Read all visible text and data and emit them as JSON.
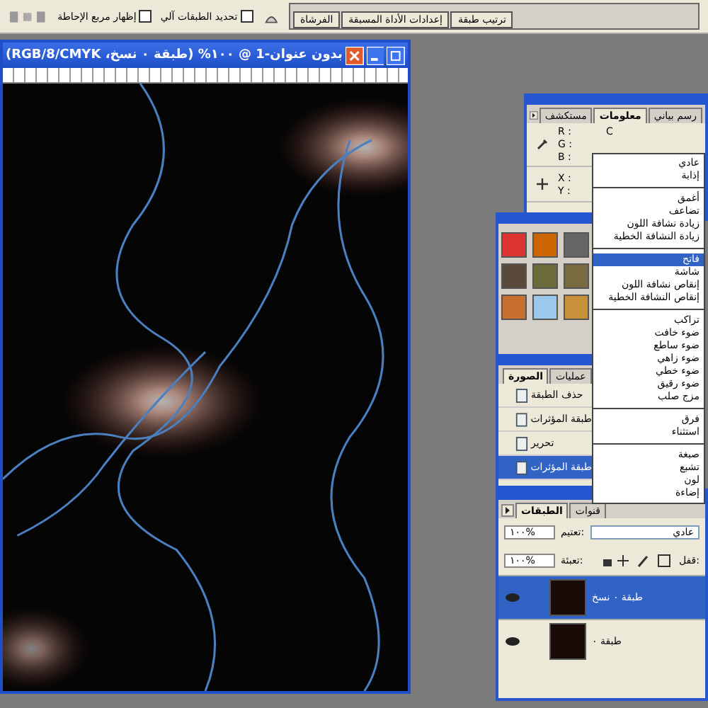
{
  "options_bar": {
    "checkboxes": [
      {
        "label": "تحديد الطبقات آلي",
        "checked": false
      },
      {
        "label": "إظهار مربع الإحاطة",
        "checked": false
      }
    ],
    "palette_tabs": [
      {
        "label": "ترتيب طبقة"
      },
      {
        "label": "إعدادات الأداة المسبقة"
      },
      {
        "label": "الفرشاة"
      }
    ]
  },
  "document": {
    "title": "بدون عنوان-1 @ ١٠٠% (طبقة ٠ نسخ، RGB/8/CMYK)"
  },
  "info_panel": {
    "tabs": [
      {
        "label": "رسم بياني",
        "selected": false
      },
      {
        "label": "معلومات",
        "selected": true
      },
      {
        "label": "مستكشف",
        "selected": false
      }
    ],
    "labels": [
      "R :",
      "G :",
      "B :"
    ],
    "c_label": "C",
    "xy_labels": [
      "X :",
      "Y :"
    ]
  },
  "blend_menu": {
    "groups": [
      [
        {
          "label": "عادي",
          "selected": false
        },
        {
          "label": "إذابة",
          "selected": false
        }
      ],
      [
        {
          "label": "أغمق",
          "selected": false
        },
        {
          "label": "تضاعف",
          "selected": false
        },
        {
          "label": "زيادة نشافة اللون",
          "selected": false
        },
        {
          "label": "زيادة النشافة الخطية",
          "selected": false
        }
      ],
      [
        {
          "label": "فاتح",
          "selected": true
        },
        {
          "label": "شاشة",
          "selected": false
        },
        {
          "label": "إنقاص نشافة اللون",
          "selected": false
        },
        {
          "label": "إنقاص النشافة الخطية",
          "selected": false
        }
      ],
      [
        {
          "label": "تراكب",
          "selected": false
        },
        {
          "label": "ضوء خافت",
          "selected": false
        },
        {
          "label": "ضوء ساطع",
          "selected": false
        },
        {
          "label": "ضوء زاهي",
          "selected": false
        },
        {
          "label": "ضوء خطي",
          "selected": false
        },
        {
          "label": "ضوء رقيق",
          "selected": false
        },
        {
          "label": "مزج صلب",
          "selected": false
        }
      ],
      [
        {
          "label": "فرق",
          "selected": false
        },
        {
          "label": "استثناء",
          "selected": false
        }
      ],
      [
        {
          "label": "صبغة",
          "selected": false
        },
        {
          "label": "تشبع",
          "selected": false
        },
        {
          "label": "لون",
          "selected": false
        },
        {
          "label": "إضاءة",
          "selected": false
        }
      ]
    ]
  },
  "history_panel": {
    "tabs": [
      {
        "label": "عمليات",
        "selected": false
      },
      {
        "label": "الصورة",
        "selected": true
      }
    ],
    "items": [
      {
        "label": "حذف الطبقة",
        "selected": false
      },
      {
        "label": "طبقة المؤثرات",
        "selected": false
      },
      {
        "label": "تحرير",
        "selected": false
      },
      {
        "label": "طبقة المؤثرات",
        "selected": true
      }
    ]
  },
  "layers_panel": {
    "tabs": [
      {
        "label": "قنوات",
        "selected": false
      },
      {
        "label": "الطبقات",
        "selected": true
      }
    ],
    "blend_mode": "عادي",
    "opacity_label": "تعتيم:",
    "opacity": "١٠٠%",
    "lock_label": "قفل:",
    "fill_label": "تعبئة:",
    "fill": "١٠٠%",
    "layers": [
      {
        "name": "طبقة ٠ نسخ",
        "selected": true,
        "visible": true
      },
      {
        "name": "طبقة ٠",
        "selected": false,
        "visible": true
      }
    ]
  }
}
